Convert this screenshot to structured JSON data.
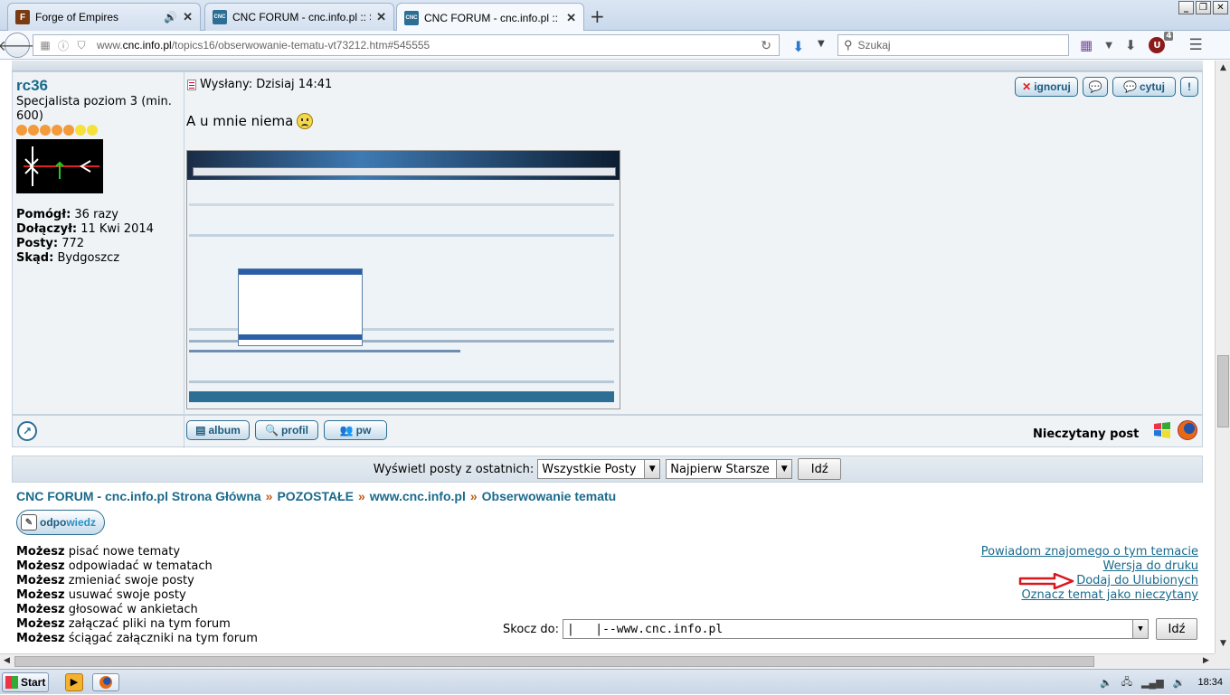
{
  "browser": {
    "tabs": [
      {
        "title": "Forge of Empires",
        "favicon_letter": "F",
        "favicon_color": "#7a3a12",
        "active": false,
        "has_audio": true
      },
      {
        "title": "CNC FORUM - cnc.info.pl :: S...",
        "favicon_letter": "CNC",
        "favicon_color": "#2d6f94",
        "active": false,
        "has_audio": false
      },
      {
        "title": "CNC FORUM - cnc.info.pl :: O...",
        "favicon_letter": "CNC",
        "favicon_color": "#2d6f94",
        "active": true,
        "has_audio": false
      }
    ],
    "url_prefix": "www.",
    "url_domain": "cnc.info.pl",
    "url_path": "/topics16/obserwowanie-tematu-vt73212.htm#545555",
    "search_placeholder": "Szukaj",
    "addon_badge": "4"
  },
  "post": {
    "author": {
      "name": "rc36",
      "rank": "Specjalista poziom 3 (min. 600)",
      "star_colors": [
        "#f39a3a",
        "#f39a3a",
        "#f39a3a",
        "#f39a3a",
        "#f39a3a",
        "#f5e13a",
        "#f5e13a"
      ],
      "stats": [
        {
          "label": "Pomógł:",
          "value": "36 razy"
        },
        {
          "label": "Dołączył:",
          "value": "11 Kwi 2014"
        },
        {
          "label": "Posty:",
          "value": "772"
        },
        {
          "label": "Skąd:",
          "value": "Bydgoszcz"
        }
      ]
    },
    "posted": "Wysłany: Dzisiaj 14:41",
    "actions": {
      "ignore": "ignoruj",
      "quote": "cytuj"
    },
    "text": "A u mnie niema",
    "footer_buttons": {
      "album": "album",
      "profile": "profil",
      "pm": "pw"
    },
    "unread_label": "Nieczytany post"
  },
  "filter": {
    "label": "Wyświetl posty z ostatnich:",
    "period": "Wszystkie Posty",
    "order": "Najpierw Starsze",
    "go": "Idź"
  },
  "breadcrumb": {
    "items": [
      "CNC FORUM - cnc.info.pl Strona Główna",
      "POZOSTAŁE",
      "www.cnc.info.pl",
      "Obserwowanie tematu"
    ],
    "separator": "»"
  },
  "reply_button": {
    "part1": "odpo",
    "part2": "wiedz"
  },
  "permissions": [
    {
      "bold": "Możesz",
      "rest": "pisać nowe tematy"
    },
    {
      "bold": "Możesz",
      "rest": "odpowiadać w tematach"
    },
    {
      "bold": "Możesz",
      "rest": "zmieniać swoje posty"
    },
    {
      "bold": "Możesz",
      "rest": "usuwać swoje posty"
    },
    {
      "bold": "Możesz",
      "rest": "głosować w ankietach"
    },
    {
      "bold": "Możesz",
      "rest": "załączać pliki na tym forum"
    },
    {
      "bold": "Możesz",
      "rest": "ściągać załączniki na tym forum"
    }
  ],
  "topic_links": [
    "Powiadom znajomego o tym temacie",
    "Wersja do druku",
    "Dodaj do Ulubionych",
    "Oznacz temat jako nieczytany"
  ],
  "jump": {
    "label": "Skocz do:",
    "value": "|   |--www.cnc.info.pl",
    "go": "Idź"
  },
  "taskbar": {
    "start": "Start",
    "clock": "18:34"
  },
  "colors": {
    "link": "#1a6a8c",
    "accent": "#2d6f94",
    "separator": "#c05a1a",
    "arrow": "#d8171e"
  }
}
